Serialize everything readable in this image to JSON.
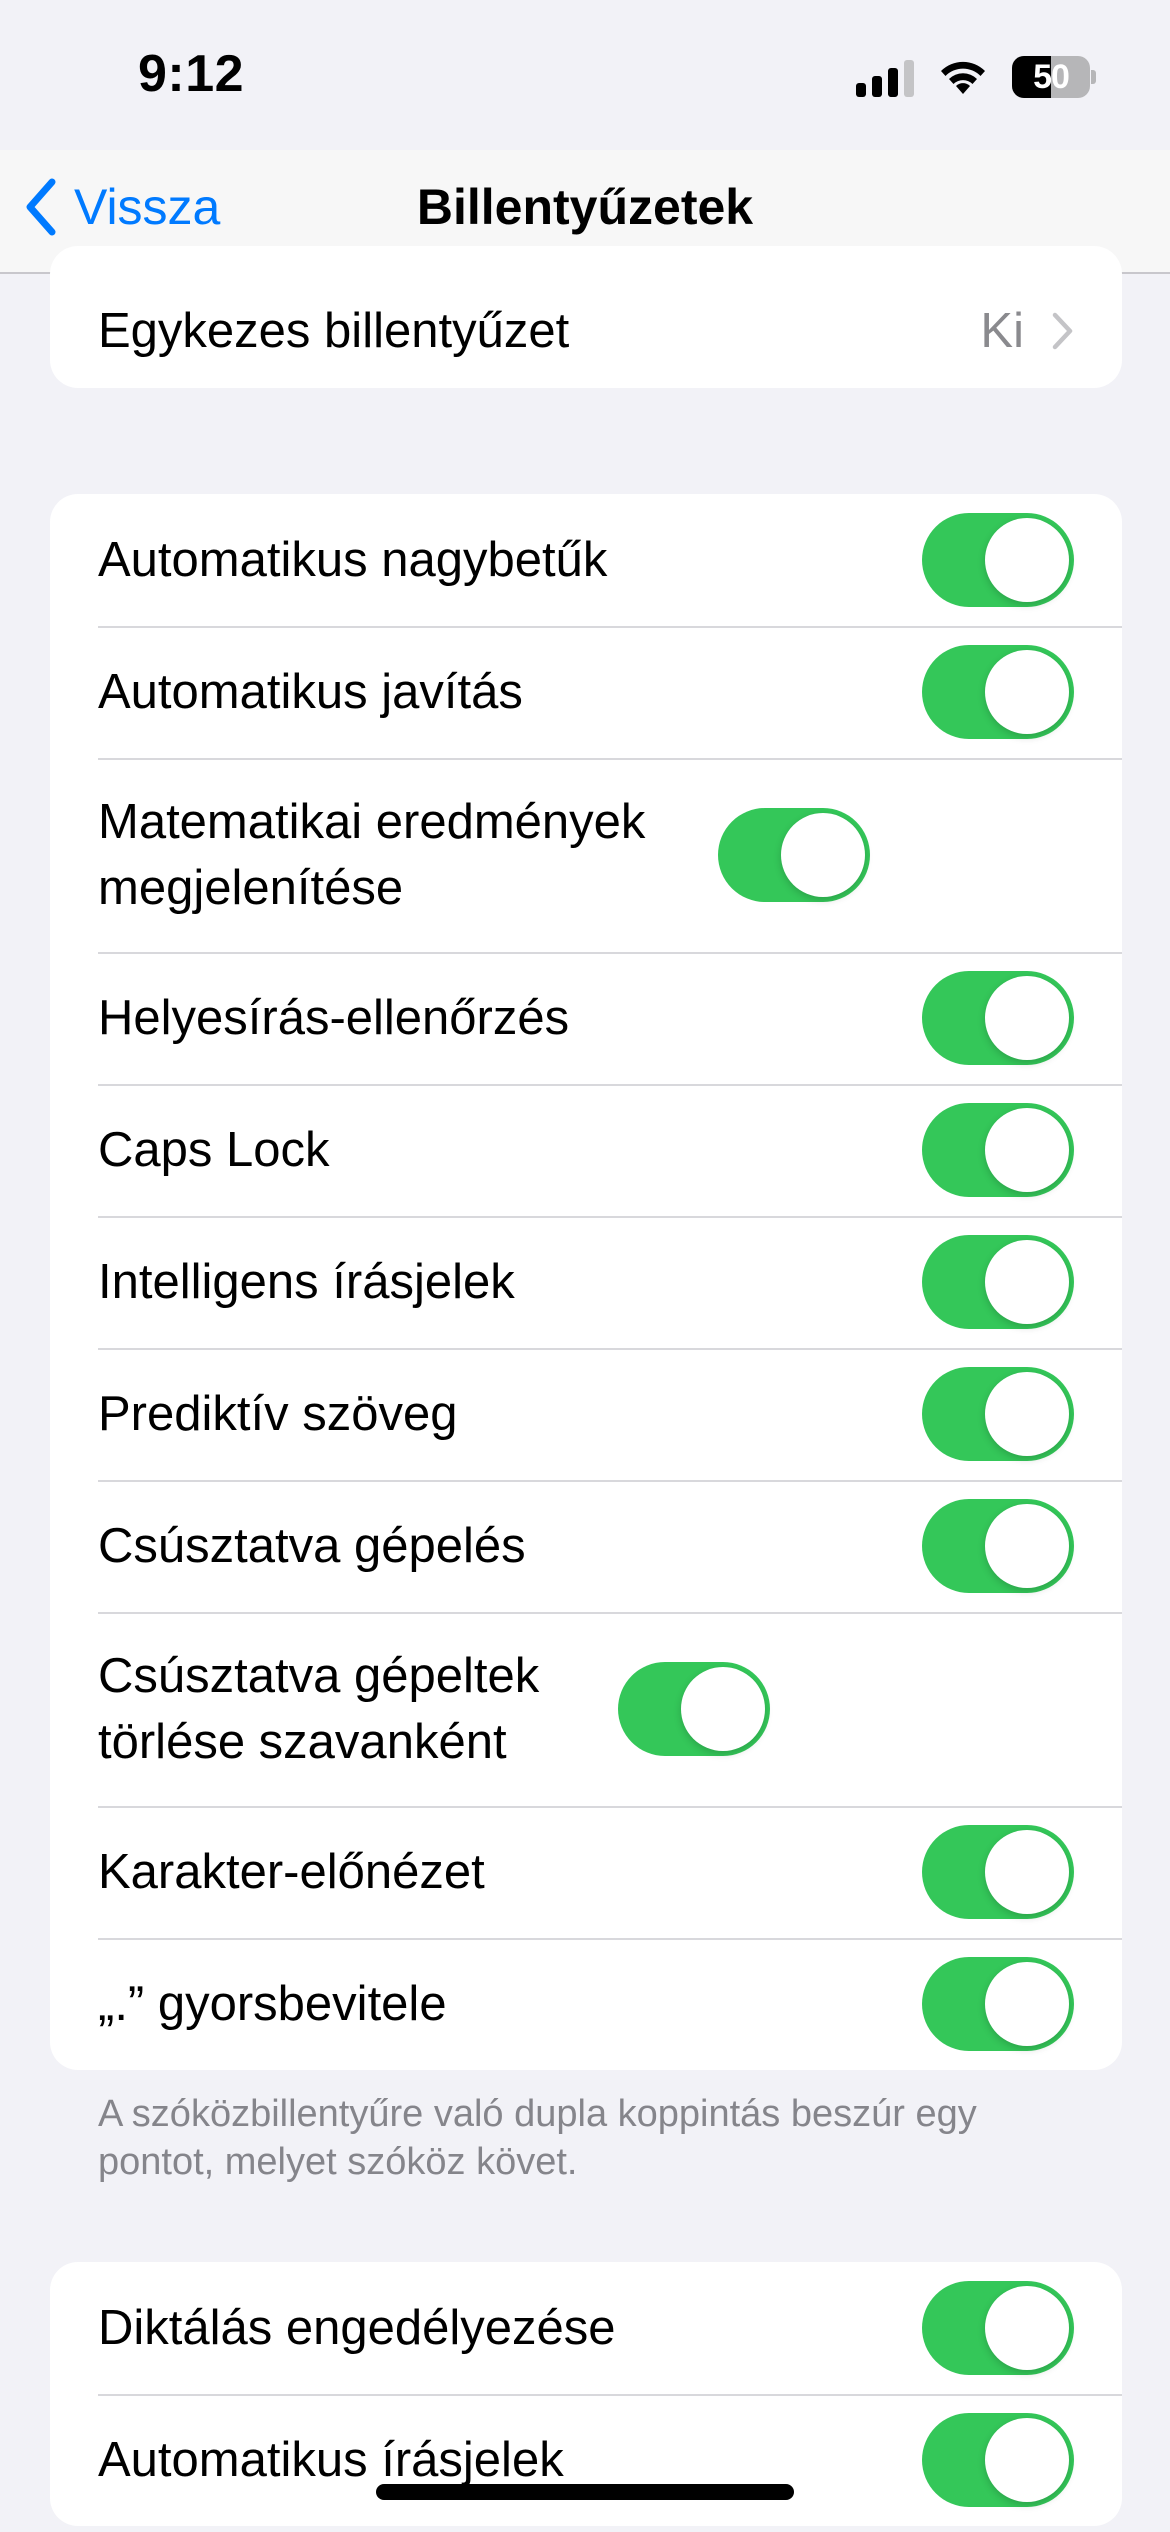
{
  "status_bar": {
    "time": "9:12",
    "battery_level": "50",
    "signal_bars_active": 3,
    "signal_bars_total": 4
  },
  "nav": {
    "back_label": "Vissza",
    "title": "Billentyűzetek"
  },
  "group_top": {
    "rows": [
      {
        "label": "Egykezes billentyűzet",
        "value": "Ki"
      }
    ]
  },
  "group_main": {
    "rows": [
      {
        "label": "Automatikus nagybetűk",
        "on": true
      },
      {
        "label": "Automatikus javítás",
        "on": true
      },
      {
        "label": "Matematikai eredmények megjelenítése",
        "on": true
      },
      {
        "label": "Helyesírás-ellenőrzés",
        "on": true
      },
      {
        "label": "Caps Lock",
        "on": true
      },
      {
        "label": "Intelligens írásjelek",
        "on": true
      },
      {
        "label": "Prediktív szöveg",
        "on": true
      },
      {
        "label": "Csúsztatva gépelés",
        "on": true
      },
      {
        "label": "Csúsztatva gépeltek törlése szavanként",
        "on": true
      },
      {
        "label": "Karakter-előnézet",
        "on": true
      },
      {
        "label": "„.” gyorsbevitele",
        "on": true
      }
    ],
    "footer": "A szóközbillentyűre való dupla koppintás beszúr egy pontot, melyet szóköz követ."
  },
  "group_dictation": {
    "rows": [
      {
        "label": "Diktálás engedélyezése",
        "on": true
      },
      {
        "label": "Automatikus írásjelek",
        "on": true
      }
    ]
  },
  "colors": {
    "accent": "#007aff",
    "toggle_on": "#34c759",
    "background": "#f2f2f7"
  }
}
